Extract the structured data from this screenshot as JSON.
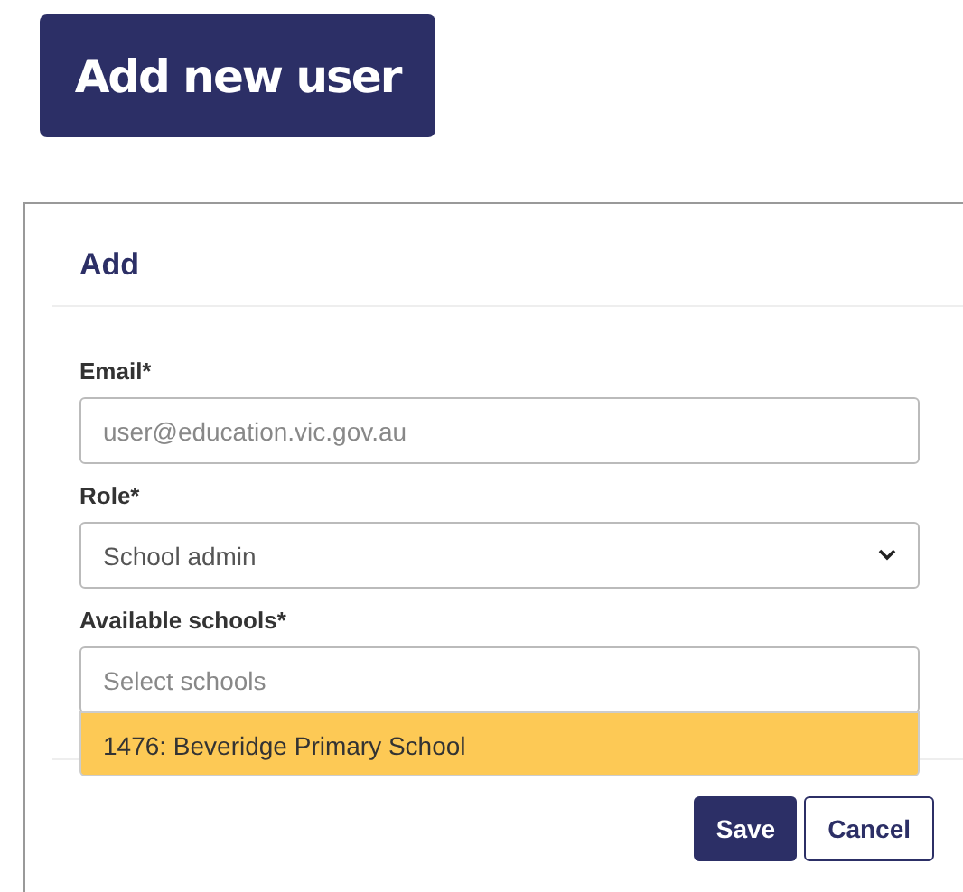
{
  "add_button": {
    "label": "Add new user"
  },
  "dialog": {
    "title": "Add",
    "email": {
      "label": "Email*",
      "placeholder": "user@education.vic.gov.au"
    },
    "role": {
      "label": "Role*",
      "value": "School admin"
    },
    "schools": {
      "label": "Available schools*",
      "placeholder": "Select schools",
      "options": [
        {
          "label": "1476: Beveridge Primary School",
          "highlighted": true
        }
      ]
    },
    "buttons": [
      {
        "label": "Save",
        "kind": "primary"
      },
      {
        "label": "Cancel",
        "kind": "secondary"
      }
    ]
  }
}
